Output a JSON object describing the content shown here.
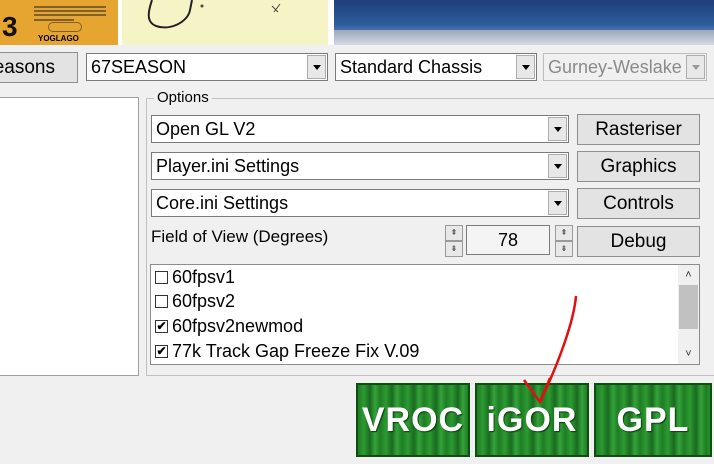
{
  "top": {
    "poster": {
      "number": "3",
      "brand": "YOGLAGO"
    }
  },
  "row1": {
    "seasons_button": "easons",
    "season_combo": "67SEASON",
    "chassis_combo": "Standard Chassis",
    "engine_combo": "Gurney-Weslake"
  },
  "options": {
    "title": "Options",
    "renderer_combo": "Open GL V2",
    "player_combo": "Player.ini Settings",
    "core_combo": "Core.ini Settings",
    "rasteriser_button": "Rasteriser",
    "graphics_button": "Graphics",
    "controls_button": "Controls",
    "debug_button": "Debug",
    "fov_label": "Field of View (Degrees)",
    "fov_value": "78",
    "spin_up": "⇞",
    "spin_down": "⇟"
  },
  "mods": {
    "items": [
      {
        "label": "60fpsv1",
        "checked": false,
        "mark": ""
      },
      {
        "label": "60fpsv2",
        "checked": false,
        "mark": ""
      },
      {
        "label": "60fpsv2newmod",
        "checked": true,
        "mark": "✔"
      },
      {
        "label": "77k Track Gap Freeze Fix V.09",
        "checked": true,
        "mark": "✔"
      }
    ],
    "scroll_up": "˄",
    "scroll_down": "˅"
  },
  "launch": {
    "vroc": "VROC",
    "igor": "iGOR",
    "gpl": "GPL"
  },
  "annotation_color": "#e01010"
}
